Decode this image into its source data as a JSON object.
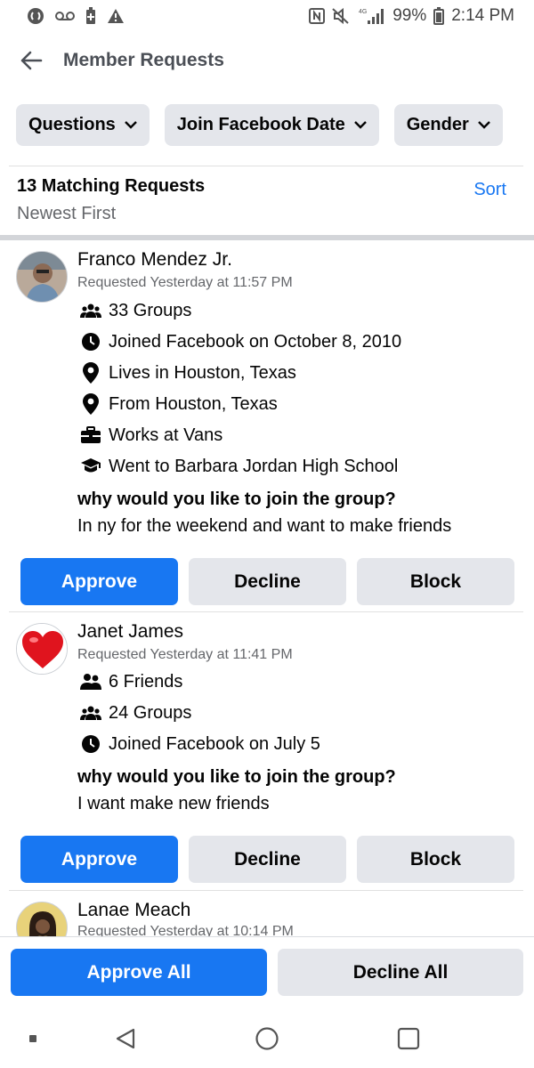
{
  "status_bar": {
    "battery": "99%",
    "time": "2:14 PM",
    "network": "4G",
    "icons_left": [
      "shazam-icon",
      "voicemail-icon",
      "battery-saver-icon",
      "warning-icon"
    ],
    "icons_right": [
      "nfc-icon",
      "mute-icon",
      "signal-icon",
      "battery-icon"
    ]
  },
  "header": {
    "title": "Member Requests"
  },
  "filters": [
    {
      "label": "Questions"
    },
    {
      "label": "Join Facebook Date"
    },
    {
      "label": "Gender"
    }
  ],
  "summary": {
    "count_label": "13 Matching Requests",
    "order_label": "Newest First",
    "sort_label": "Sort"
  },
  "requests": [
    {
      "name": "Franco Mendez Jr.",
      "requested": "Requested Yesterday at 11:57 PM",
      "details": [
        {
          "icon": "groups-icon",
          "text": "33 Groups"
        },
        {
          "icon": "clock-icon",
          "text": "Joined Facebook on October 8, 2010"
        },
        {
          "icon": "location-pin-icon",
          "text": "Lives in Houston, Texas"
        },
        {
          "icon": "location-pin-icon",
          "text": "From Houston, Texas"
        },
        {
          "icon": "briefcase-icon",
          "text": "Works at Vans"
        },
        {
          "icon": "graduation-cap-icon",
          "text": "Went to Barbara Jordan High School"
        }
      ],
      "question": "why would you like to join the group?",
      "answer": "In ny for the weekend and want to make friends",
      "approve": "Approve",
      "decline": "Decline",
      "block": "Block"
    },
    {
      "name": "Janet James",
      "requested": "Requested Yesterday at 11:41 PM",
      "details": [
        {
          "icon": "friends-icon",
          "text": "6 Friends"
        },
        {
          "icon": "groups-icon",
          "text": "24 Groups"
        },
        {
          "icon": "clock-icon",
          "text": "Joined Facebook on July 5"
        }
      ],
      "question": "why would you like to join the group?",
      "answer": "I want make new friends",
      "approve": "Approve",
      "decline": "Decline",
      "block": "Block"
    },
    {
      "name": "Lanae Meach",
      "requested": "Requested Yesterday at 10:14 PM"
    }
  ],
  "bottom_actions": {
    "approve_all": "Approve All",
    "decline_all": "Decline All"
  },
  "colors": {
    "accent": "#1877f2",
    "chip_bg": "#e4e6eb",
    "muted_text": "#65676b"
  }
}
